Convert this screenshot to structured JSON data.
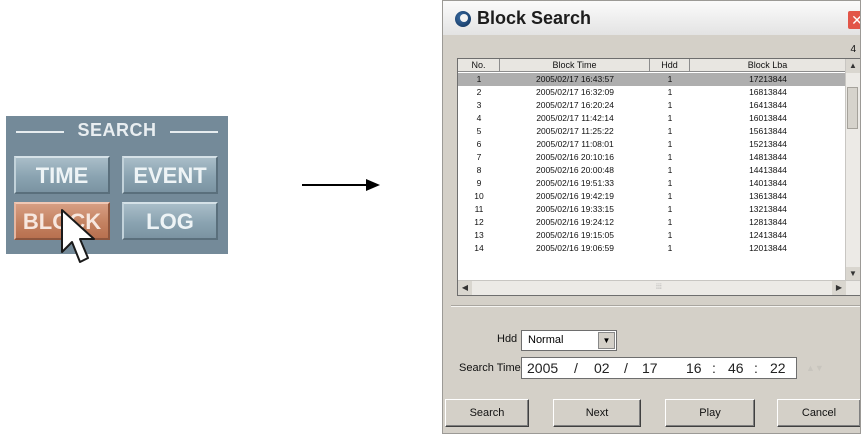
{
  "search_panel": {
    "title": "SEARCH",
    "buttons": [
      {
        "label": "TIME",
        "active": false
      },
      {
        "label": "EVENT",
        "active": false
      },
      {
        "label": "BLOCK",
        "active": true
      },
      {
        "label": "LOG",
        "active": false
      }
    ]
  },
  "dialog": {
    "title": "Block Search",
    "close_glyph": "✕",
    "corner_text": "4",
    "columns": [
      "No.",
      "Block Time",
      "Hdd",
      "Block Lba"
    ],
    "rows": [
      [
        "1",
        "2005/02/17 16:43:57",
        "1",
        "17213844"
      ],
      [
        "2",
        "2005/02/17 16:32:09",
        "1",
        "16813844"
      ],
      [
        "3",
        "2005/02/17 16:20:24",
        "1",
        "16413844"
      ],
      [
        "4",
        "2005/02/17 11:42:14",
        "1",
        "16013844"
      ],
      [
        "5",
        "2005/02/17 11:25:22",
        "1",
        "15613844"
      ],
      [
        "6",
        "2005/02/17 11:08:01",
        "1",
        "15213844"
      ],
      [
        "7",
        "2005/02/16 20:10:16",
        "1",
        "14813844"
      ],
      [
        "8",
        "2005/02/16 20:00:48",
        "1",
        "14413844"
      ],
      [
        "9",
        "2005/02/16 19:51:33",
        "1",
        "14013844"
      ],
      [
        "10",
        "2005/02/16 19:42:19",
        "1",
        "13613844"
      ],
      [
        "11",
        "2005/02/16 19:33:15",
        "1",
        "13213844"
      ],
      [
        "12",
        "2005/02/16 19:24:12",
        "1",
        "12813844"
      ],
      [
        "13",
        "2005/02/16 19:15:05",
        "1",
        "12413844"
      ],
      [
        "14",
        "2005/02/16 19:06:59",
        "1",
        "12013844"
      ]
    ],
    "selected_row": 0,
    "hdd_label": "Hdd :",
    "hdd_value": "Normal",
    "search_time_label": "Search Time :",
    "search_time": {
      "year": "2005",
      "month": "02",
      "day": "17",
      "hour": "16",
      "minute": "46",
      "second": "22"
    },
    "date_sep": "/",
    "time_sep": ":",
    "buttons": {
      "search": "Search",
      "next": "Next",
      "play": "Play",
      "cancel": "Cancel"
    }
  }
}
